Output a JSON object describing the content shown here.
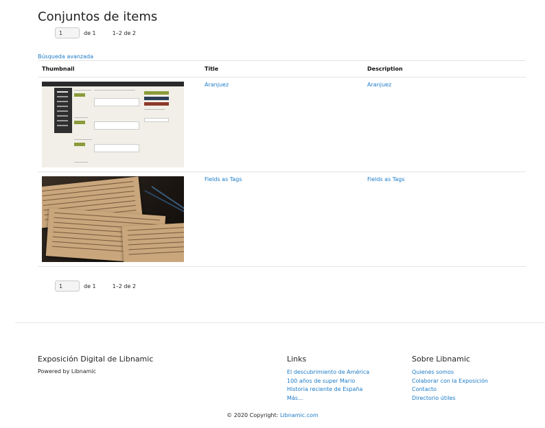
{
  "page": {
    "title": "Conjuntos de items"
  },
  "pagination": {
    "page_value": "1",
    "of_label": "de 1",
    "range_label": "1–2 de 2"
  },
  "search": {
    "advanced_label": "Búsqueda avanzada"
  },
  "table": {
    "headers": {
      "thumbnail": "Thumbnail",
      "title": "Title",
      "description": "Description"
    },
    "rows": [
      {
        "title": "Aranjuez",
        "description": "Aranjuez",
        "thumbnail_alt": "admin-screenshot"
      },
      {
        "title": "Fields as Tags",
        "description": "Fields as Tags",
        "thumbnail_alt": "handwritten-papers"
      }
    ]
  },
  "footer": {
    "site": {
      "title": "Exposición Digital de Libnamic",
      "powered": "Powered by Libnamic"
    },
    "links": {
      "title": "Links",
      "items": [
        "El descubrimiento de América",
        "100 años de super Mario",
        "Historia reciente de España",
        "Más..."
      ]
    },
    "about": {
      "title": "Sobre Libnamic",
      "items": [
        "Quienes somos",
        "Colaborar con la Exposición",
        "Contacto",
        "Directorio útiles"
      ]
    },
    "copyright_prefix": "© 2020 Copyright: ",
    "copyright_link": "Libnamic.com"
  }
}
